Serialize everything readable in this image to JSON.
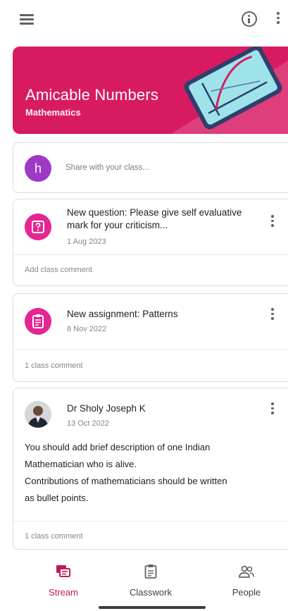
{
  "class": {
    "title": "Amicable Numbers",
    "subject": "Mathematics"
  },
  "share": {
    "avatar_letter": "h",
    "placeholder": "Share with your class..."
  },
  "posts": [
    {
      "type": "question",
      "title": "New question: Please give self evaluative mark for your criticism...",
      "date": "1 Aug 2023",
      "comment_label": "Add class comment"
    },
    {
      "type": "assignment",
      "title": "New assignment: Patterns",
      "date": "8 Nov 2022",
      "comment_label": "1 class comment"
    },
    {
      "type": "announcement",
      "author": "Dr Sholy Joseph K",
      "date": "13 Oct 2022",
      "body_lines": [
        "You should add brief description of one Indian",
        "Mathematician who is alive.",
        "Contributions of mathematicians should be written",
        "as bullet points."
      ],
      "comment_label": "1 class comment"
    }
  ],
  "nav": {
    "stream": "Stream",
    "classwork": "Classwork",
    "people": "People"
  },
  "colors": {
    "banner": "#d81b60",
    "accent": "#e52592",
    "avatar": "#9c39c7",
    "active_nav": "#c2185b"
  },
  "icons": {
    "menu": "menu-icon",
    "info": "info-icon",
    "more": "more-vert-icon",
    "question": "question-icon",
    "assignment": "assignment-icon",
    "stream": "stream-icon",
    "classwork": "classwork-icon",
    "people": "people-icon"
  }
}
